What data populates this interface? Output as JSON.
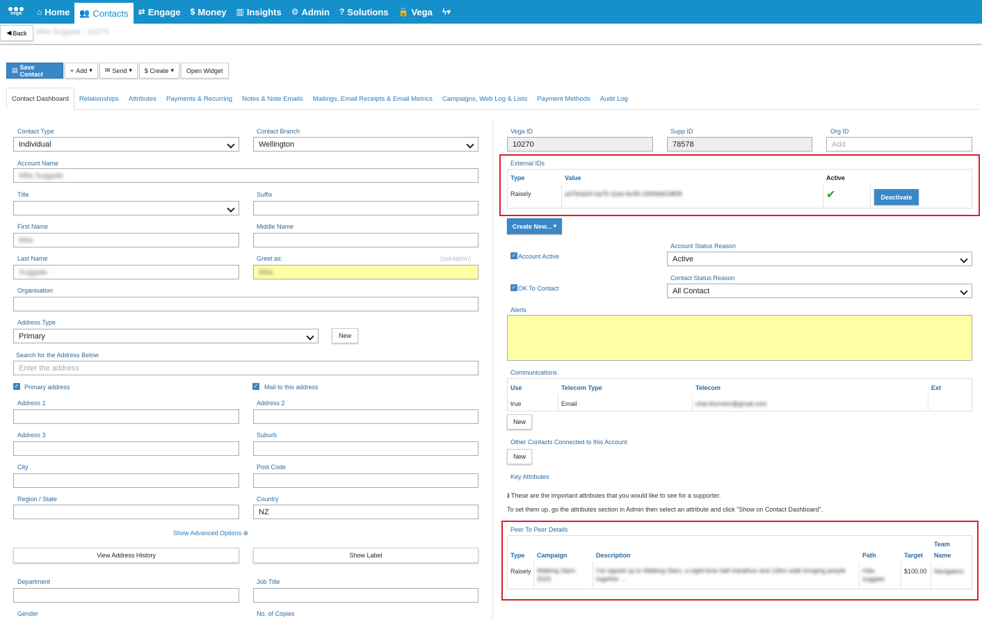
{
  "nav": {
    "logo_text": "vega",
    "items": [
      {
        "label": "Home",
        "icon": "⌂"
      },
      {
        "label": "Contacts",
        "icon": "👥"
      },
      {
        "label": "Engage",
        "icon": "⇄"
      },
      {
        "label": "Money",
        "icon": "$"
      },
      {
        "label": "Insights",
        "icon": "▥"
      },
      {
        "label": "Admin",
        "icon": "⚙"
      },
      {
        "label": "Solutions",
        "icon": "?"
      },
      {
        "label": "Vega",
        "icon": "🔒"
      },
      {
        "label": "",
        "icon": "ϟ▾"
      }
    ]
  },
  "subheader": {
    "back_label": "Back",
    "breadcrumb": "Mila Suggate - 10270"
  },
  "toolbar": {
    "save": "Save Contact",
    "add": "Add",
    "send": "Send",
    "create": "$ Create",
    "widget": "Open Widget"
  },
  "tabs": [
    "Contact Dashboard",
    "Relationships",
    "Attributes",
    "Payments & Recurring",
    "Notes & Note Emails",
    "Mailings, Email Receipts & Email Metrics",
    "Campaigns, Web Log & Lists",
    "Payment Methods",
    "Audit Log"
  ],
  "left": {
    "contact_type": {
      "label": "Contact Type",
      "value": "Individual"
    },
    "contact_branch": {
      "label": "Contact Branch",
      "value": "Wellington"
    },
    "account_name": {
      "label": "Account Name",
      "value": "Mila Suggate"
    },
    "title": {
      "label": "Title",
      "value": ""
    },
    "suffix": {
      "label": "Suffix",
      "value": ""
    },
    "first_name": {
      "label": "First Name",
      "value": "Mila"
    },
    "middle_name": {
      "label": "Middle Name",
      "value": ""
    },
    "last_name": {
      "label": "Last Name",
      "value": "Suggate"
    },
    "greet_as": {
      "label": "Greet as:",
      "hint": "(salutation)",
      "value": "Mila"
    },
    "organisation": {
      "label": "Organisation",
      "value": ""
    },
    "address_type": {
      "label": "Address Type",
      "value": "Primary",
      "new": "New"
    },
    "search_address": {
      "label": "Search for the Address Below",
      "placeholder": "Enter the address"
    },
    "primary_address": "Primary address",
    "mail_to": "Mail to this address",
    "address1": "Address 1",
    "address2": "Address 2",
    "address3": "Address 3",
    "suburb": "Suburb",
    "city": "City",
    "post_code": "Post Code",
    "region": "Region / State",
    "country": {
      "label": "Country",
      "value": "NZ"
    },
    "advanced": "Show Advanced Options",
    "view_history": "View Address History",
    "show_label": "Show Label",
    "department": "Department",
    "job_title": "Job Title",
    "gender": "Gender",
    "copies": "No. of Copies"
  },
  "right": {
    "vega_id": {
      "label": "Vega ID",
      "value": "10270"
    },
    "supp_id": {
      "label": "Supp ID",
      "value": "78578"
    },
    "org_id": {
      "label": "Org ID",
      "placeholder": "Add"
    },
    "external_ids": {
      "title": "External IDs",
      "headers": [
        "Type",
        "Value",
        "Active"
      ],
      "row": {
        "type": "Raisely",
        "value": "a47b0a00-0a75-11ee-9c99-1990bb61f808",
        "deactivate": "Deactivate"
      }
    },
    "create_new": "Create New...",
    "account_active": "Account Active",
    "account_status_reason": {
      "label": "Account Status Reason",
      "value": "Active"
    },
    "ok_to_contact": "OK To Contact",
    "contact_status_reason": {
      "label": "Contact Status Reason",
      "value": "All Contact"
    },
    "alerts": "Alerts",
    "communications": {
      "title": "Communications",
      "headers": [
        "Use",
        "Telecom Type",
        "Telecom",
        "Ext"
      ],
      "row": {
        "use": "true",
        "type": "Email",
        "telecom": "char.thornton@gmail.com",
        "ext": ""
      },
      "new": "New"
    },
    "other_contacts": {
      "title": "Other Contacts Connected to this Account",
      "new": "New"
    },
    "key_attributes": {
      "title": "Key Attributes",
      "info1": "These are the important attributes that you would like to see for a supporter.",
      "info2": "To set them up, go the attributes section in Admin then select an attribute and click \"Show on Contact Dashboard\"."
    },
    "p2p": {
      "title": "Peer To Peer Details",
      "headers": [
        "Type",
        "Campaign",
        "Description",
        "Path",
        "Target",
        "Team",
        "Name"
      ],
      "row": {
        "type": "Raisely",
        "campaign": "Walking Stars 2023",
        "description": "I've signed up to Walking Stars, a night-time half marathon and 12km walk bringing people together ...",
        "path": "mila-suggate",
        "target": "$100.00",
        "team": "Navigators"
      }
    }
  }
}
